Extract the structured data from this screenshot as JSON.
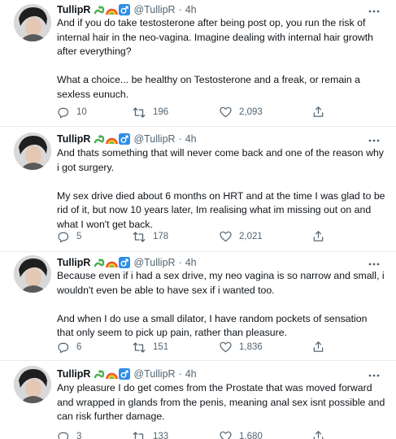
{
  "tweets": [
    {
      "display_name": "TullipR",
      "handle": "@TullipR",
      "separator": "·",
      "time": "4h",
      "paragraphs": [
        "And if you do take testosterone after being post op, you run the risk of internal hair in the neo-vagina. Imagine dealing with internal hair growth after everything?",
        "What a choice... be healthy on Testosterone and a freak, or remain a sexless eunuch."
      ],
      "replies": "10",
      "retweets": "196",
      "likes": "2,093"
    },
    {
      "display_name": "TullipR",
      "handle": "@TullipR",
      "separator": "·",
      "time": "4h",
      "paragraphs": [
        "And thats something that will never come back and one of the reason why i got surgery.",
        "My sex drive died about 6 months on HRT and at the time I was glad to be rid of it, but now 10 years later, Im realising what im missing out on and what I won't get back."
      ],
      "replies": "5",
      "retweets": "178",
      "likes": "2,021"
    },
    {
      "display_name": "TullipR",
      "handle": "@TullipR",
      "separator": "·",
      "time": "4h",
      "paragraphs": [
        "Because even if i had a sex drive, my neo vagina is so narrow and small, i wouldn't even be able to have sex if i wanted too.",
        "And when I do use a small dilator, I have random pockets of sensation that only seem to pick up pain, rather than pleasure."
      ],
      "replies": "6",
      "retweets": "151",
      "likes": "1,836"
    },
    {
      "display_name": "TullipR",
      "handle": "@TullipR",
      "separator": "·",
      "time": "4h",
      "paragraphs": [
        "Any pleasure I do get comes from the Prostate that was moved forward and wrapped in glands from the penis, meaning anal sex isnt possible and can risk further damage."
      ],
      "replies": "3",
      "retweets": "133",
      "likes": "1,680"
    }
  ],
  "icons": {
    "name_emojis": [
      "snake-emoji",
      "rainbow-emoji",
      "male-sign-emoji"
    ],
    "reply": "reply-icon",
    "retweet": "retweet-icon",
    "like": "heart-icon",
    "share": "share-icon",
    "more": "more-icon"
  },
  "colors": {
    "text": "#0f1419",
    "secondary": "#536471",
    "divider": "#e6ecf0",
    "male_sign_bg": "#2f8ee6"
  }
}
